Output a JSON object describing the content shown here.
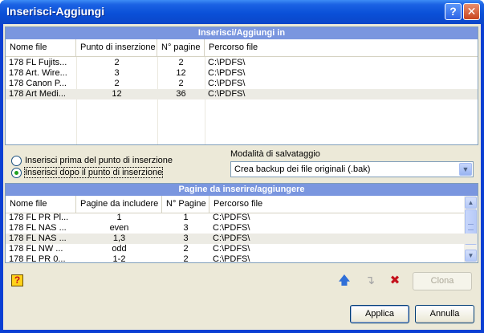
{
  "window": {
    "title": "Inserisci-Aggiungi",
    "help_glyph": "?",
    "close_glyph": "✕"
  },
  "top_grid": {
    "title": "Inserisci/Aggiungi in",
    "columns": [
      "Nome file",
      "Punto di inserzione",
      "N° pagine",
      "Percorso file"
    ],
    "rows": [
      [
        "178 FL Fujits...",
        "2",
        "2",
        "C:\\PDFS\\"
      ],
      [
        "178 Art. Wire...",
        "3",
        "12",
        "C:\\PDFS\\"
      ],
      [
        "178 Canon P...",
        "2",
        "2",
        "C:\\PDFS\\"
      ],
      [
        "178 Art Medi...",
        "12",
        "36",
        "C:\\PDFS\\"
      ]
    ],
    "selected_row": 3
  },
  "insert_options": {
    "before_label": "Inserisci prima del punto di inserzione",
    "after_label": "Inserisci dopo il punto di inserzione",
    "selected": "after"
  },
  "save_mode": {
    "label": "Modalità di salvataggio",
    "value": "Crea backup dei file originali (.bak)"
  },
  "bottom_grid": {
    "title": "Pagine da inserire/aggiungere",
    "columns": [
      "Nome file",
      "Pagine da includere",
      "N° Pagine",
      "Percorso file"
    ],
    "rows": [
      [
        "178 FL PR Pl...",
        "1",
        "1",
        "C:\\PDFS\\"
      ],
      [
        "178 FL NAS ...",
        "even",
        "3",
        "C:\\PDFS\\"
      ],
      [
        "178 FL NAS ...",
        "1,3",
        "3",
        "C:\\PDFS\\"
      ],
      [
        "178 FL NW ...",
        "odd",
        "2",
        "C:\\PDFS\\"
      ],
      [
        "178 FL PR 0...",
        "1-2",
        "2",
        "C:\\PDFS\\"
      ]
    ],
    "selected_row": 2
  },
  "toolbar": {
    "help_icon": "help-question-icon",
    "up_icon": "arrow-up-icon",
    "down_icon": "arrow-down-icon",
    "delete_icon": "delete-x-icon"
  },
  "buttons": {
    "clone": "Clona",
    "apply": "Applica",
    "cancel": "Annulla"
  },
  "colors": {
    "titlebar": "#0a50d8",
    "grid_title": "#7a96df",
    "face": "#ece9d8",
    "delete": "#c4121c",
    "up_arrow": "#2f6fd8"
  }
}
